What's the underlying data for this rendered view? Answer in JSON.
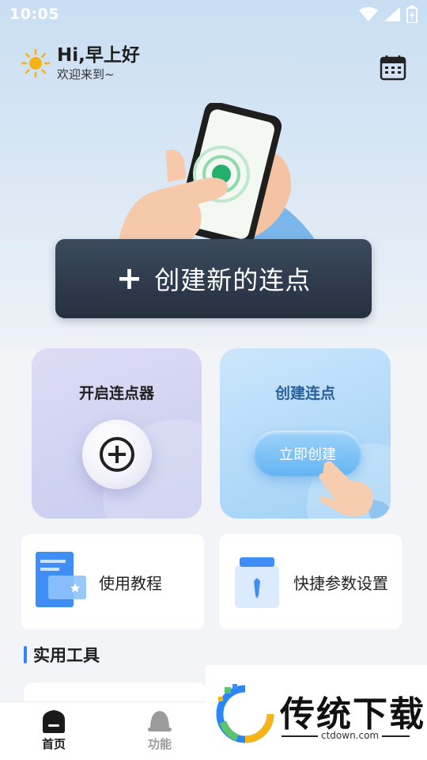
{
  "status_bar": {
    "time": "10:05"
  },
  "header": {
    "greeting": "Hi,早上好",
    "subtitle": "欢迎来到~"
  },
  "banner": {
    "create_label": "创建新的连点"
  },
  "cards": {
    "open": {
      "title": "开启连点器"
    },
    "create": {
      "title": "创建连点",
      "button": "立即创建"
    }
  },
  "features": [
    {
      "label": "使用教程"
    },
    {
      "label": "快捷参数设置"
    }
  ],
  "section": {
    "title": "实用工具"
  },
  "nav": [
    {
      "label": "首页"
    },
    {
      "label": "功能"
    }
  ],
  "watermark": {
    "brand": "传统下载",
    "url": "ctdown.com"
  },
  "colors": {
    "accent": "#2d86f5",
    "banner_dark": "#2b3646",
    "sun": "#f6b316"
  }
}
